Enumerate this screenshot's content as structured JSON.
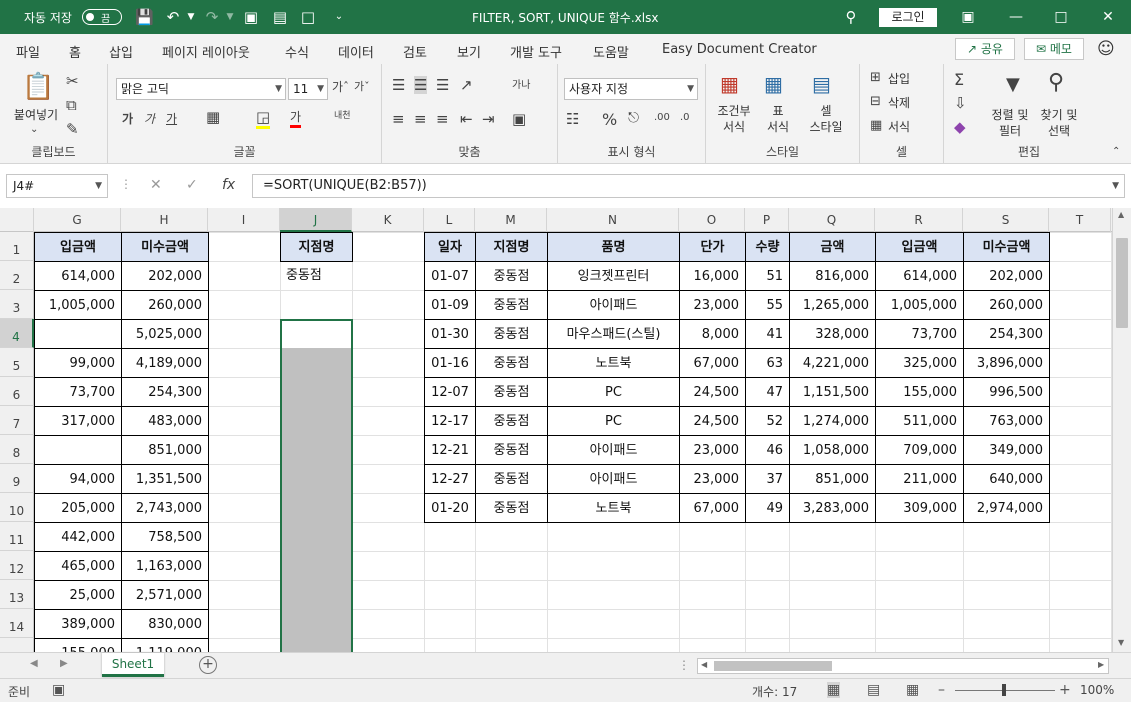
{
  "titlebar": {
    "autosave_label": "자동 저장",
    "toggle_state": "끔",
    "filename": "FILTER, SORT, UNIQUE 함수.xlsx",
    "login_label": "로그인"
  },
  "menu": {
    "tabs": [
      "파일",
      "홈",
      "삽입",
      "페이지 레이아웃",
      "수식",
      "데이터",
      "검토",
      "보기",
      "개발 도구",
      "도움말",
      "Easy Document Creator"
    ],
    "active_tab": "홈",
    "share_label": "공유",
    "memo_label": "메모"
  },
  "ribbon": {
    "clipboard": {
      "paste": "붙여넣기",
      "group": "클립보드"
    },
    "font": {
      "font_name": "맑은 고딕",
      "font_size": "11",
      "bold": "가",
      "italic": "가",
      "underline": "가",
      "group": "글꼴"
    },
    "alignment": {
      "group": "맞춤"
    },
    "number": {
      "format": "사용자 지정",
      "group": "표시 형식"
    },
    "styles": {
      "conditional_line1": "조건부",
      "conditional_line2": "서식",
      "table_line1": "표",
      "table_line2": "서식",
      "cell_line1": "셀",
      "cell_line2": "스타일",
      "group": "스타일"
    },
    "cells": {
      "insert": "삽입",
      "delete": "삭제",
      "format": "서식",
      "group": "셀"
    },
    "editing": {
      "sort_line1": "정렬 및",
      "sort_line2": "필터",
      "find_line1": "찾기 및",
      "find_line2": "선택",
      "group": "편집"
    }
  },
  "formula_bar": {
    "name_box": "J4#",
    "formula": "=SORT(UNIQUE(B2:B57))"
  },
  "columns": [
    "G",
    "H",
    "I",
    "J",
    "K",
    "L",
    "M",
    "N",
    "O",
    "P",
    "Q",
    "R",
    "S",
    "T"
  ],
  "selected_column": "J",
  "rows": [
    "1",
    "2",
    "3",
    "4",
    "5",
    "6",
    "7",
    "8",
    "9",
    "10",
    "11",
    "12",
    "13",
    "14"
  ],
  "selected_row": "4",
  "left_table": {
    "headers": [
      "입금액",
      "미수금액"
    ],
    "rows": [
      [
        "614,000",
        "202,000"
      ],
      [
        "1,005,000",
        "260,000"
      ],
      [
        "",
        "5,025,000"
      ],
      [
        "99,000",
        "4,189,000"
      ],
      [
        "73,700",
        "254,300"
      ],
      [
        "317,000",
        "483,000"
      ],
      [
        "",
        "851,000"
      ],
      [
        "94,000",
        "1,351,500"
      ],
      [
        "205,000",
        "2,743,000"
      ],
      [
        "442,000",
        "758,500"
      ],
      [
        "465,000",
        "1,163,000"
      ],
      [
        "25,000",
        "2,571,000"
      ],
      [
        "389,000",
        "830,000"
      ],
      [
        "155,000",
        "1,119,000"
      ]
    ]
  },
  "j_column": {
    "header": "지점명",
    "values": [
      "중동점"
    ]
  },
  "right_table": {
    "headers": [
      "일자",
      "지점명",
      "품명",
      "단가",
      "수량",
      "금액",
      "입금액",
      "미수금액"
    ],
    "rows": [
      [
        "01-07",
        "중동점",
        "잉크젯프린터",
        "16,000",
        "51",
        "816,000",
        "614,000",
        "202,000"
      ],
      [
        "01-09",
        "중동점",
        "아이패드",
        "23,000",
        "55",
        "1,265,000",
        "1,005,000",
        "260,000"
      ],
      [
        "01-30",
        "중동점",
        "마우스패드(스틸)",
        "8,000",
        "41",
        "328,000",
        "73,700",
        "254,300"
      ],
      [
        "01-16",
        "중동점",
        "노트북",
        "67,000",
        "63",
        "4,221,000",
        "325,000",
        "3,896,000"
      ],
      [
        "12-07",
        "중동점",
        "PC",
        "24,500",
        "47",
        "1,151,500",
        "155,000",
        "996,500"
      ],
      [
        "12-17",
        "중동점",
        "PC",
        "24,500",
        "52",
        "1,274,000",
        "511,000",
        "763,000"
      ],
      [
        "12-21",
        "중동점",
        "아이패드",
        "23,000",
        "46",
        "1,058,000",
        "709,000",
        "349,000"
      ],
      [
        "12-27",
        "중동점",
        "아이패드",
        "23,000",
        "37",
        "851,000",
        "211,000",
        "640,000"
      ],
      [
        "01-20",
        "중동점",
        "노트북",
        "67,000",
        "49",
        "3,283,000",
        "309,000",
        "2,974,000"
      ]
    ]
  },
  "sheet_tab": "Sheet1",
  "status": {
    "ready": "준비",
    "count": "개수: 17",
    "zoom": "100%"
  },
  "colors": {
    "accent": "#217346",
    "header_fill": "#dae3f3",
    "spill_fill": "#c0c0c0"
  }
}
